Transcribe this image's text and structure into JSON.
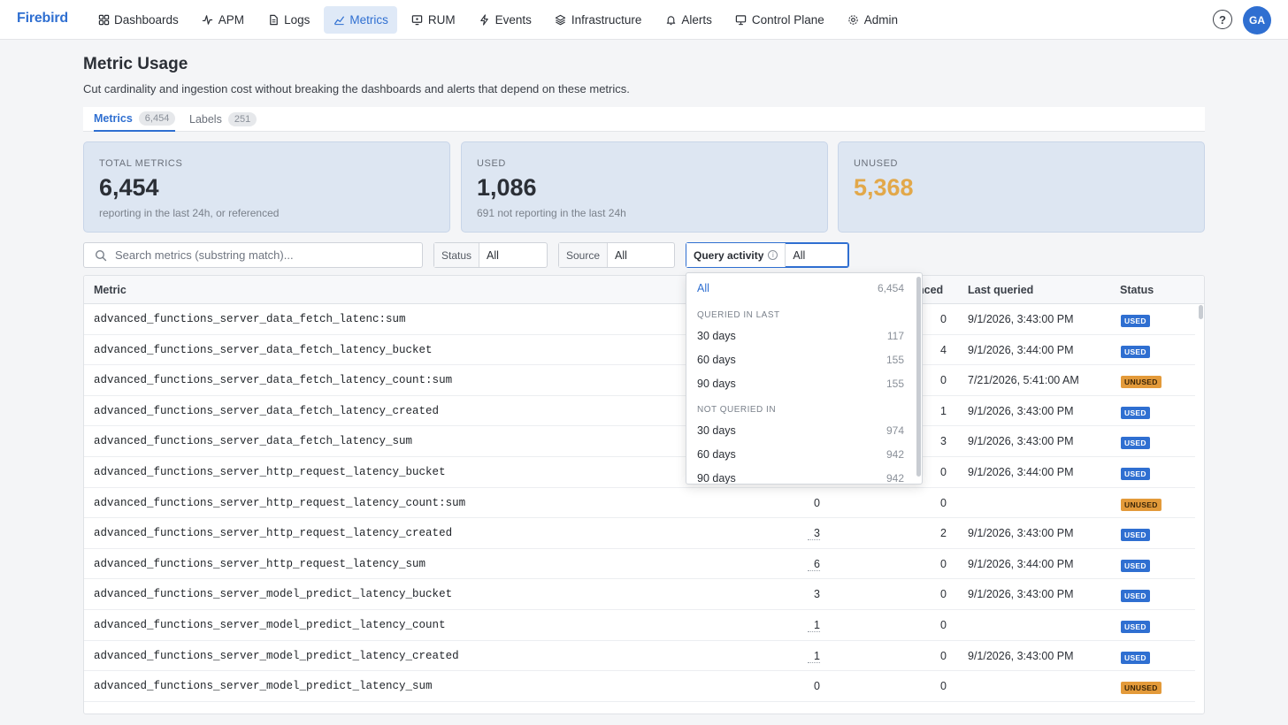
{
  "brand": "Firebird",
  "nav": [
    {
      "label": "Dashboards",
      "icon": "grid-icon",
      "active": false
    },
    {
      "label": "APM",
      "icon": "pulse-icon",
      "active": false
    },
    {
      "label": "Logs",
      "icon": "document-icon",
      "active": false
    },
    {
      "label": "Metrics",
      "icon": "chart-icon",
      "active": true
    },
    {
      "label": "RUM",
      "icon": "monitor-icon",
      "active": false
    },
    {
      "label": "Events",
      "icon": "bolt-icon",
      "active": false
    },
    {
      "label": "Infrastructure",
      "icon": "layers-icon",
      "active": false
    },
    {
      "label": "Alerts",
      "icon": "bell-icon",
      "active": false
    },
    {
      "label": "Control Plane",
      "icon": "display-icon",
      "active": false
    },
    {
      "label": "Admin",
      "icon": "gear-icon",
      "active": false
    }
  ],
  "help_label": "?",
  "avatar_initials": "GA",
  "page": {
    "title": "Metric Usage",
    "subtitle": "Cut cardinality and ingestion cost without breaking the dashboards and alerts that depend on these metrics."
  },
  "tabs": [
    {
      "label": "Metrics",
      "count": "6,454",
      "active": true
    },
    {
      "label": "Labels",
      "count": "251",
      "active": false
    }
  ],
  "stats": [
    {
      "label": "TOTAL METRICS",
      "value": "6,454",
      "note": "reporting in the last 24h, or referenced"
    },
    {
      "label": "USED",
      "value": "1,086",
      "note": "691 not reporting in the last 24h"
    },
    {
      "label": "UNUSED",
      "value": "5,368",
      "note": ""
    }
  ],
  "accent_colors": {
    "primary": "#2f6fd1",
    "used": "#2f6fd1",
    "unused": "#e39a3a",
    "unused_value": "#e2a84a"
  },
  "search": {
    "placeholder": "Search metrics (substring match)...",
    "value": ""
  },
  "filters": {
    "status": {
      "label": "Status",
      "value": "All"
    },
    "source": {
      "label": "Source",
      "value": "All"
    },
    "query_activity": {
      "label": "Query activity",
      "value": "All"
    }
  },
  "table": {
    "columns": [
      "Metric",
      "nced",
      "Last queried",
      "Status"
    ],
    "rows": [
      {
        "metric": "advanced_functions_server_data_fetch_latenc:sum",
        "c1": "",
        "c2": "0",
        "last": "9/1/2026, 3:43:00 PM",
        "status": "USED"
      },
      {
        "metric": "advanced_functions_server_data_fetch_latency_bucket",
        "c1": "",
        "c2": "4",
        "last": "9/1/2026, 3:44:00 PM",
        "status": "USED"
      },
      {
        "metric": "advanced_functions_server_data_fetch_latency_count:sum",
        "c1": "",
        "c2": "0",
        "last": "7/21/2026, 5:41:00 AM",
        "status": "UNUSED"
      },
      {
        "metric": "advanced_functions_server_data_fetch_latency_created",
        "c1": "",
        "c2": "1",
        "last": "9/1/2026, 3:43:00 PM",
        "status": "USED"
      },
      {
        "metric": "advanced_functions_server_data_fetch_latency_sum",
        "c1": "",
        "c2": "3",
        "last": "9/1/2026, 3:43:00 PM",
        "status": "USED"
      },
      {
        "metric": "advanced_functions_server_http_request_latency_bucket",
        "c1": "",
        "c2": "0",
        "last": "9/1/2026, 3:44:00 PM",
        "status": "USED"
      },
      {
        "metric": "advanced_functions_server_http_request_latency_count:sum",
        "c1": "0",
        "c2": "0",
        "last": "",
        "status": "UNUSED"
      },
      {
        "metric": "advanced_functions_server_http_request_latency_created",
        "c1": "3",
        "c2": "2",
        "last": "9/1/2026, 3:43:00 PM",
        "status": "USED"
      },
      {
        "metric": "advanced_functions_server_http_request_latency_sum",
        "c1": "6",
        "c2": "0",
        "last": "9/1/2026, 3:44:00 PM",
        "status": "USED"
      },
      {
        "metric": "advanced_functions_server_model_predict_latency_bucket",
        "c1": "3",
        "c2": "0",
        "last": "9/1/2026, 3:43:00 PM",
        "status": "USED"
      },
      {
        "metric": "advanced_functions_server_model_predict_latency_count",
        "c1": "1",
        "c2": "0",
        "last": "",
        "status": "USED"
      },
      {
        "metric": "advanced_functions_server_model_predict_latency_created",
        "c1": "1",
        "c2": "0",
        "last": "9/1/2026, 3:43:00 PM",
        "status": "USED"
      },
      {
        "metric": "advanced_functions_server_model_predict_latency_sum",
        "c1": "0",
        "c2": "0",
        "last": "",
        "status": "UNUSED"
      }
    ]
  },
  "dropdown": {
    "all": {
      "label": "All",
      "count": "6,454"
    },
    "section_queried": "QUERIED IN LAST",
    "queried": [
      {
        "label": "30 days",
        "count": "117"
      },
      {
        "label": "60 days",
        "count": "155"
      },
      {
        "label": "90 days",
        "count": "155"
      }
    ],
    "section_not_queried": "NOT QUERIED IN",
    "not_queried": [
      {
        "label": "30 days",
        "count": "974"
      },
      {
        "label": "60 days",
        "count": "942"
      },
      {
        "label": "90 days",
        "count": "942"
      }
    ]
  }
}
